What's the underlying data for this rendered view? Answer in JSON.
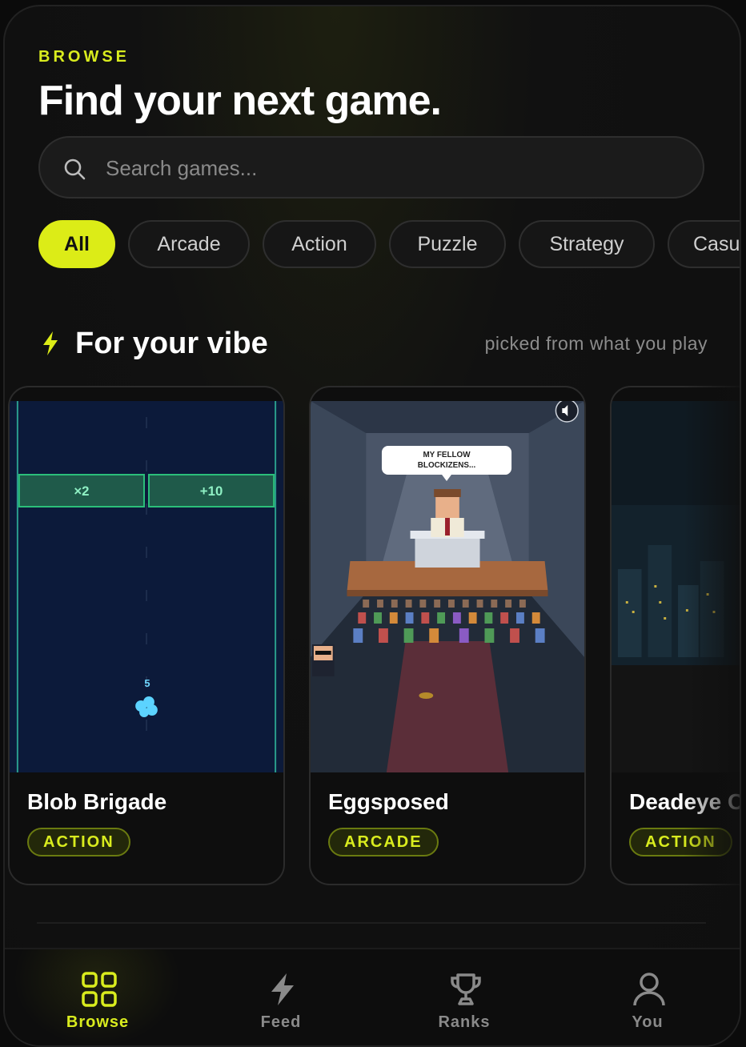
{
  "header": {
    "eyebrow": "BROWSE",
    "title": "Find your next game."
  },
  "search": {
    "placeholder": "Search games..."
  },
  "filters": {
    "selected": "All",
    "items": [
      {
        "label": "All"
      },
      {
        "label": "Arcade"
      },
      {
        "label": "Action"
      },
      {
        "label": "Puzzle"
      },
      {
        "label": "Strategy"
      },
      {
        "label": "Casu"
      }
    ]
  },
  "section": {
    "title": "For your vibe",
    "subtitle": "picked from what you play"
  },
  "cards": [
    {
      "title": "Blob Brigade",
      "genre": "ACTION",
      "preview": {
        "gate_left": "×2",
        "gate_right": "+10",
        "count": "5"
      }
    },
    {
      "title": "Eggsposed",
      "genre": "ARCADE",
      "preview": {
        "speech_line1": "MY FELLOW",
        "speech_line2": "BLOCKIZENS..."
      }
    },
    {
      "title": "Deadeye C",
      "genre": "ACTION"
    }
  ],
  "tabbar": {
    "active": "Browse",
    "tabs": [
      {
        "label": "Browse",
        "icon": "grid-icon"
      },
      {
        "label": "Feed",
        "icon": "bolt-icon"
      },
      {
        "label": "Ranks",
        "icon": "trophy-icon"
      },
      {
        "label": "You",
        "icon": "user-icon"
      }
    ]
  },
  "colors": {
    "accent": "#dcec17",
    "background": "#0f0f0f",
    "blob_preview_bg": "#0c1a3a",
    "gate_green": "#2bbf7a"
  }
}
